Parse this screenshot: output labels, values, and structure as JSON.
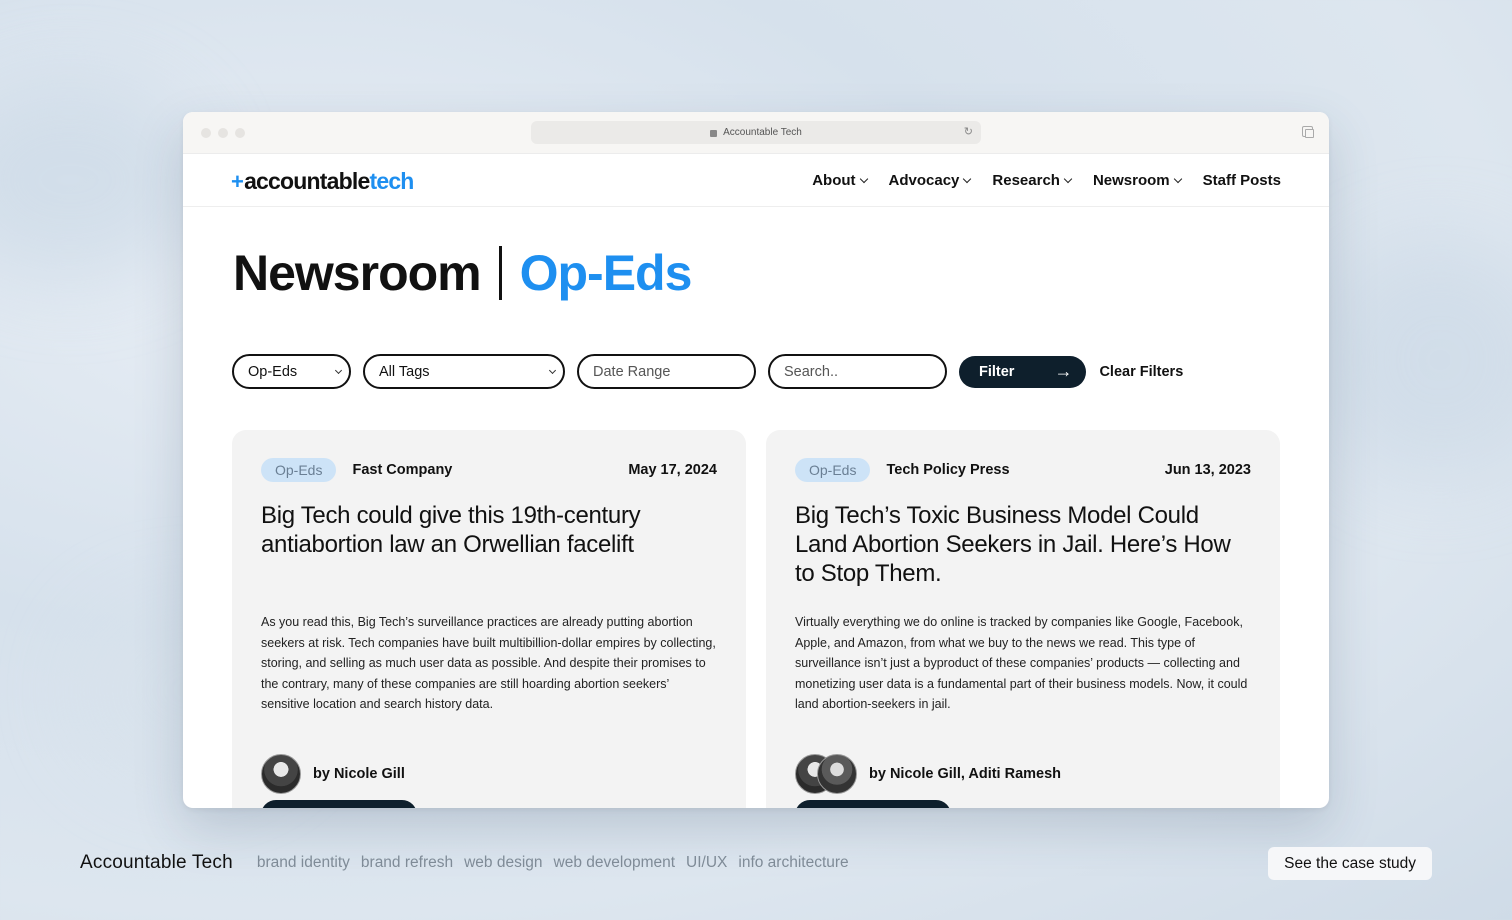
{
  "browser": {
    "url_label": "Accountable Tech",
    "reload_icon": "↻"
  },
  "site": {
    "logo_plus": "+",
    "logo_main": "accountable",
    "logo_accent": "tech",
    "brand_color": "#1e8ff0",
    "nav": [
      {
        "label": "About"
      },
      {
        "label": "Advocacy"
      },
      {
        "label": "Research"
      },
      {
        "label": "Newsroom"
      },
      {
        "label": "Staff Posts"
      }
    ]
  },
  "page": {
    "title": "Newsroom",
    "subtitle": "Op-Eds"
  },
  "filters": {
    "category_value": "Op-Eds",
    "tags_value": "All Tags",
    "date_placeholder": "Date Range",
    "search_placeholder": "Search..",
    "filter_label": "Filter",
    "filter_icon": "→",
    "clear_label": "Clear Filters"
  },
  "cards": [
    {
      "tag": "Op-Eds",
      "source": "Fast Company",
      "date": "May 17, 2024",
      "title": "Big Tech could give this 19th-century antiabortion law an Orwellian facelift",
      "body": "As you read this, Big Tech’s surveillance practices are already putting abortion seekers at risk. Tech companies have built multibillion-dollar empires by collecting, storing, and selling as much user data as possible. And despite their promises to the contrary, many of these companies are still hoarding abortion seekers’ sensitive location and search history data.",
      "author": "by Nicole Gill"
    },
    {
      "tag": "Op-Eds",
      "source": "Tech Policy Press",
      "date": "Jun 13, 2023",
      "title": "Big Tech’s Toxic Business Model Could Land Abortion Seekers in Jail. Here’s How to Stop Them.",
      "body": "Virtually everything we do online is tracked by companies like Google, Facebook, Apple, and Amazon, from what we buy to the news we read. This type of surveillance isn’t just a byproduct of these companies’ products — collecting and monetizing user data is a fundamental part of their business models. Now, it could land abortion-seekers in jail.",
      "author": "by Nicole Gill, Aditi Ramesh"
    }
  ],
  "footer": {
    "title": "Accountable Tech",
    "tags": [
      "brand identity",
      "brand refresh",
      "web design",
      "web development",
      "UI/UX",
      "info architecture"
    ],
    "cta": "See the case study"
  }
}
